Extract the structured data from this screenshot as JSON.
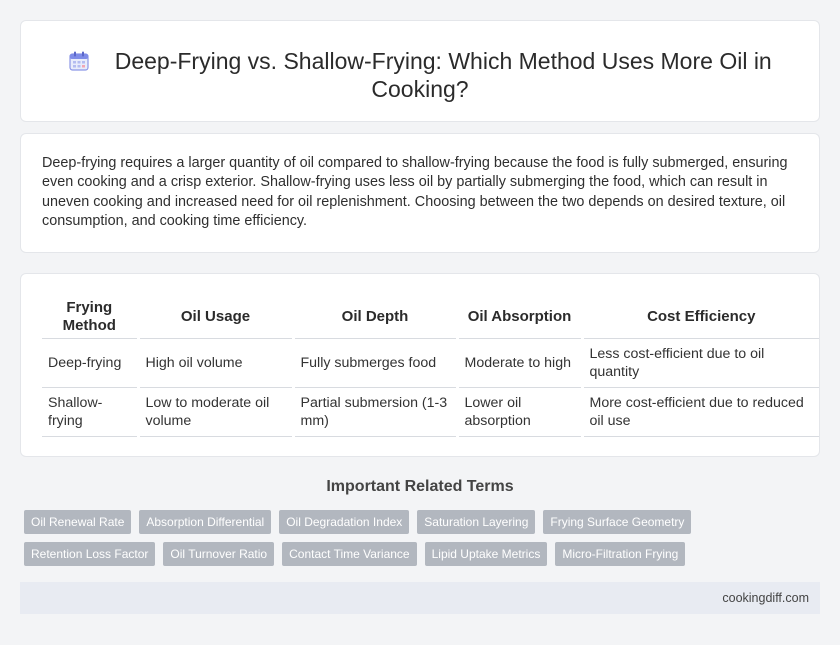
{
  "header": {
    "title": "Deep-Frying vs. Shallow-Frying: Which Method Uses More Oil in Cooking?",
    "icon": "calendar-icon"
  },
  "summary": {
    "text": "Deep-frying requires a larger quantity of oil compared to shallow-frying because the food is fully submerged, ensuring even cooking and a crisp exterior. Shallow-frying uses less oil by partially submerging the food, which can result in uneven cooking and increased need for oil replenishment. Choosing between the two depends on desired texture, oil consumption, and cooking time efficiency."
  },
  "table": {
    "headers": [
      "Frying Method",
      "Oil Usage",
      "Oil Depth",
      "Oil Absorption",
      "Cost Efficiency"
    ],
    "rows": [
      [
        "Deep-frying",
        "High oil volume",
        "Fully submerges food",
        "Moderate to high",
        "Less cost-efficient due to oil quantity"
      ],
      [
        "Shallow-frying",
        "Low to moderate oil volume",
        "Partial submersion (1-3 mm)",
        "Lower oil absorption",
        "More cost-efficient due to reduced oil use"
      ]
    ]
  },
  "related": {
    "heading": "Important Related Terms",
    "tags_row1": [
      "Oil Renewal Rate",
      "Absorption Differential",
      "Oil Degradation Index",
      "Saturation Layering",
      "Frying Surface Geometry"
    ],
    "tags_row2": [
      "Retention Loss Factor",
      "Oil Turnover Ratio",
      "Contact Time Variance",
      "Lipid Uptake Metrics",
      "Micro-Filtration Frying"
    ]
  },
  "footer": {
    "site": "cookingdiff.com"
  },
  "colors": {
    "background": "#f3f4f6",
    "tag": "#b2b7bf",
    "footer": "#e8ebf2",
    "icon_accent": "#6d7ee8"
  }
}
